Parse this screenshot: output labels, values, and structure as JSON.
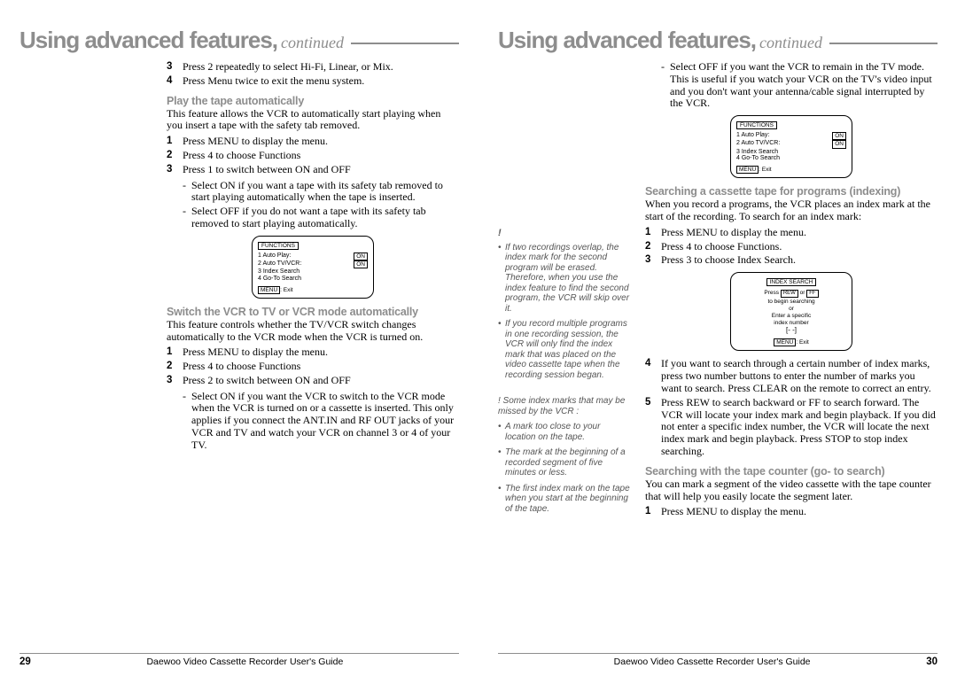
{
  "title": {
    "main": "Using advanced features,",
    "cont": "continued"
  },
  "footer": {
    "guide": "Daewoo Video Cassette Recorder User's Guide",
    "pn_left": "29",
    "pn_right": "30"
  },
  "left": {
    "pre_steps": [
      {
        "n": "3",
        "t": "Press 2 repeatedly to select Hi-Fi, Linear, or Mix."
      },
      {
        "n": "4",
        "t": "Press Menu twice to exit the menu system."
      }
    ],
    "sec1": {
      "head": "Play the tape automatically",
      "intro": "This feature allows the VCR to automatically start playing when you insert a tape with the safety tab removed.",
      "steps": [
        {
          "n": "1",
          "t": "Press MENU to display the menu."
        },
        {
          "n": "2",
          "t": "Press 4 to choose Functions"
        },
        {
          "n": "3",
          "t": "Press 1 to switch between ON and OFF"
        }
      ],
      "subs": [
        "Select ON if you want a tape with its safety tab removed to start playing automatically when the tape is inserted.",
        "Select OFF if you do not want a tape with its safety tab removed to start playing automatically."
      ]
    },
    "osd1": {
      "title_box": "FUNCTIONS",
      "rows": [
        {
          "l": "1 Auto Play:",
          "v": "ON"
        },
        {
          "l": "2 Auto TV/VCR:",
          "v": "ON"
        },
        {
          "l": "3 Index Search",
          "v": ""
        },
        {
          "l": "4 Go-To Search",
          "v": ""
        }
      ],
      "menu_exit_a": "MENU",
      "menu_exit_b": ": Exit"
    },
    "sec2": {
      "head": "Switch the VCR to TV or VCR mode automatically",
      "intro": "This feature controls whether the TV/VCR switch changes automatically to the VCR mode when the VCR is turned on.",
      "steps": [
        {
          "n": "1",
          "t": "Press MENU to display the menu."
        },
        {
          "n": "2",
          "t": "Press 4 to choose Functions"
        },
        {
          "n": "3",
          "t": "Press 2 to switch between ON and OFF"
        }
      ],
      "subs": [
        "Select ON if you want the VCR to switch to the VCR mode when the VCR is turned on or a cassette is inserted. This only applies if you connect the ANT.IN and RF OUT jacks of your VCR and TV and watch your VCR on channel 3 or 4 of your TV."
      ]
    }
  },
  "right": {
    "pre_subs": [
      "Select OFF if you want the VCR to remain in the TV mode. This is useful if you watch your VCR on the TV's video input and you don't want your antenna/cable signal interrupted by the VCR."
    ],
    "osd2": {
      "title_box": "FUNCTIONS",
      "rows": [
        {
          "l": "1 Auto Play:",
          "v": "ON"
        },
        {
          "l": "2 Auto TV/VCR:",
          "v": "ON"
        },
        {
          "l": "3 Index Search",
          "v": ""
        },
        {
          "l": "4 Go-To Search",
          "v": ""
        }
      ],
      "menu_exit_a": "MENU",
      "menu_exit_b": ": Exit"
    },
    "sec1": {
      "head": "Searching a cassette tape for programs (indexing)",
      "intro": "When you record a programs, the VCR places an index mark at the start of the recording. To search for an index mark:",
      "steps": [
        {
          "n": "1",
          "t": "Press MENU to display the menu."
        },
        {
          "n": "2",
          "t": "Press 4 to choose Functions."
        },
        {
          "n": "3",
          "t": "Press 3 to choose Index Search."
        }
      ]
    },
    "osd3": {
      "title_box": "INDEX SEARCH",
      "line1a": "Press ",
      "line1b": "REW",
      "line1c": " or ",
      "line1d": "FF",
      "line2": "to begin searching",
      "line3": "or",
      "line4": "Enter a specific",
      "line5": "index number",
      "line6": "[- -]",
      "menu_exit_a": "MENU",
      "menu_exit_b": ": Exit"
    },
    "more_steps": [
      {
        "n": "4",
        "t": "If you want to search through a certain number of index marks, press two number buttons to enter the number of marks you want to search. Press CLEAR on the remote to correct an entry."
      },
      {
        "n": "5",
        "t": "Press REW to search backward or FF to search forward. The VCR will locate your index mark and begin playback. If you did not enter a specific index number, the VCR will locate the next index mark and begin playback. Press STOP to stop index searching."
      }
    ],
    "sec2": {
      "head": "Searching with the tape counter (go- to search)",
      "intro": "You can mark a segment of the video cassette with the tape counter that will help you easily locate the segment later.",
      "steps": [
        {
          "n": "1",
          "t": "Press MENU to display the menu."
        }
      ]
    },
    "notes": {
      "exclaim": "!",
      "n1": "If two recordings overlap, the index mark for the second program will be erased. Therefore, when you use the index feature to find the second program, the VCR will skip over it.",
      "n2": "If you record multiple programs in one recording session, the VCR will only find the index mark that was placed on the video cassette tape when the recording session began.",
      "lead2": "! Some index marks  that may be missed by the VCR :",
      "n3": "A mark too close to your location on the tape.",
      "n4": "The mark at the beginning of a recorded segment of five minutes or less.",
      "n5": "The first index mark on the tape when you start at the beginning of the tape."
    }
  }
}
